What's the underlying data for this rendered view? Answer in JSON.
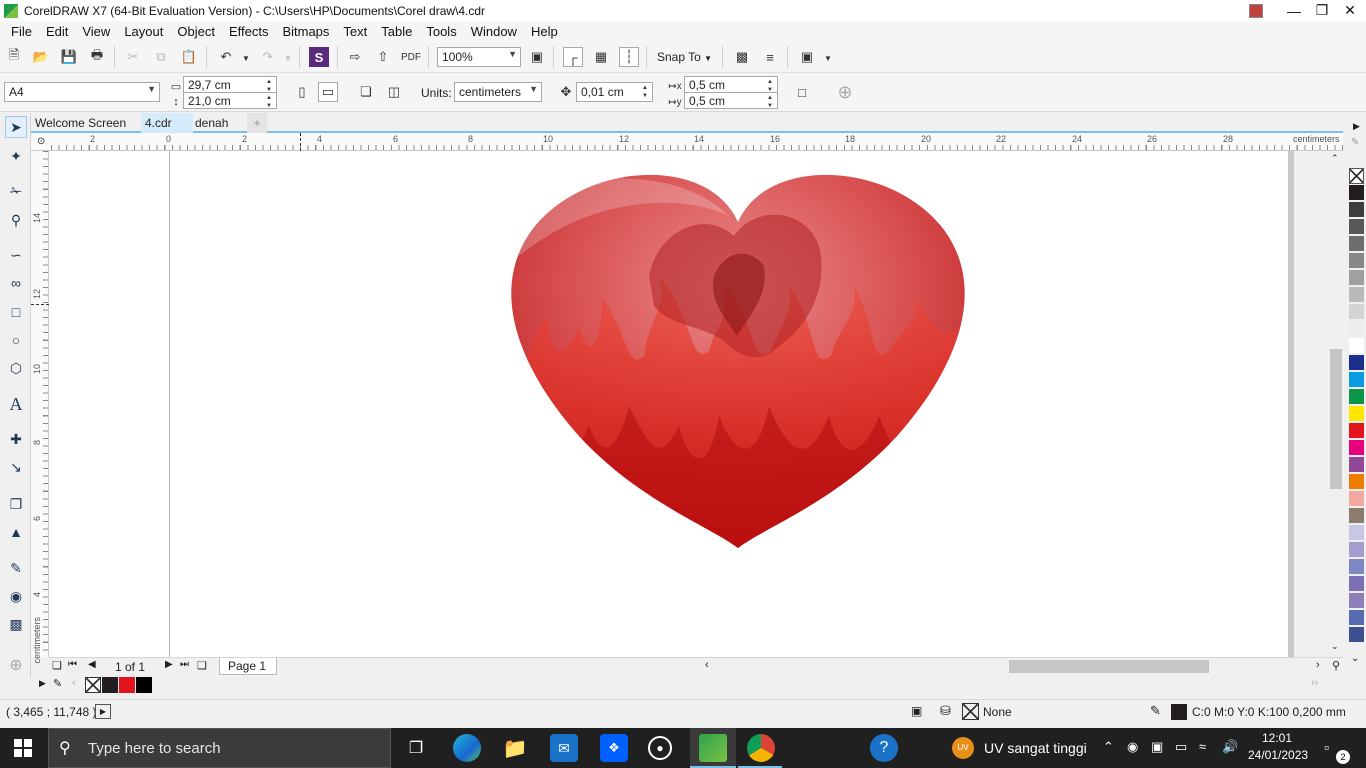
{
  "window": {
    "title": "CorelDRAW X7 (64-Bit Evaluation Version) - C:\\Users\\HP\\Documents\\Corel draw\\4.cdr",
    "controls": [
      "user-icon",
      "minimize-icon",
      "restore-icon",
      "close-icon"
    ]
  },
  "menu": [
    "File",
    "Edit",
    "View",
    "Layout",
    "Object",
    "Effects",
    "Bitmaps",
    "Text",
    "Table",
    "Tools",
    "Window",
    "Help"
  ],
  "standard_toolbar": {
    "zoom_level": "100%",
    "snap_to_label": "Snap To"
  },
  "property_bar": {
    "page_size": "A4",
    "width": "29,7 cm",
    "height": "21,0 cm",
    "units_label": "Units:",
    "units_value": "centimeters",
    "nudge": "0,01 cm",
    "dup_x": "0,5 cm",
    "dup_y": "0,5 cm"
  },
  "doc_tabs": [
    "Welcome Screen",
    "4.cdr",
    "denah"
  ],
  "active_tab": "4.cdr",
  "rulers": {
    "h_ticks": [
      "2",
      "0",
      "2",
      "4",
      "6",
      "8",
      "10",
      "12",
      "14",
      "16",
      "18",
      "20",
      "22",
      "24",
      "26",
      "28"
    ],
    "h_unit": "centimeters",
    "v_ticks": [
      "14",
      "12",
      "10",
      "8",
      "6",
      "4"
    ],
    "v_unit": "centimeters"
  },
  "page_nav": {
    "counter": "1 of 1",
    "page_tab": "Page 1"
  },
  "palette_colors": [
    "none",
    "#231f20",
    "#3d3d3d",
    "#585858",
    "#6e6e6e",
    "#878787",
    "#a0a0a0",
    "#bababa",
    "#d4d4d4",
    "#ececec",
    "#ffffff",
    "#1b2f8f",
    "#0b9be0",
    "#0c9646",
    "#ffe600",
    "#e3141c",
    "#e6007e",
    "#8f4898",
    "#ee7d00",
    "#f4a9a0",
    "#8b7c6d",
    "#c9c7e6",
    "#a39ecf",
    "#7d88c4",
    "#7c6fb3",
    "#8e7fb8",
    "#566bb0",
    "#3e4f8f"
  ],
  "document_palette": [
    "none",
    "#231f20",
    "#e3141c",
    "#000000"
  ],
  "status": {
    "cursor_pos": "( 3,465 ; 11,748 )",
    "fill_label": "None",
    "outline_label": "C:0 M:0 Y:0 K:100  0,200 mm"
  },
  "taskbar": {
    "search_placeholder": "Type here to search",
    "weather": "UV sangat tinggi",
    "time": "12:01",
    "date": "24/01/2023",
    "notif_count": "2"
  }
}
